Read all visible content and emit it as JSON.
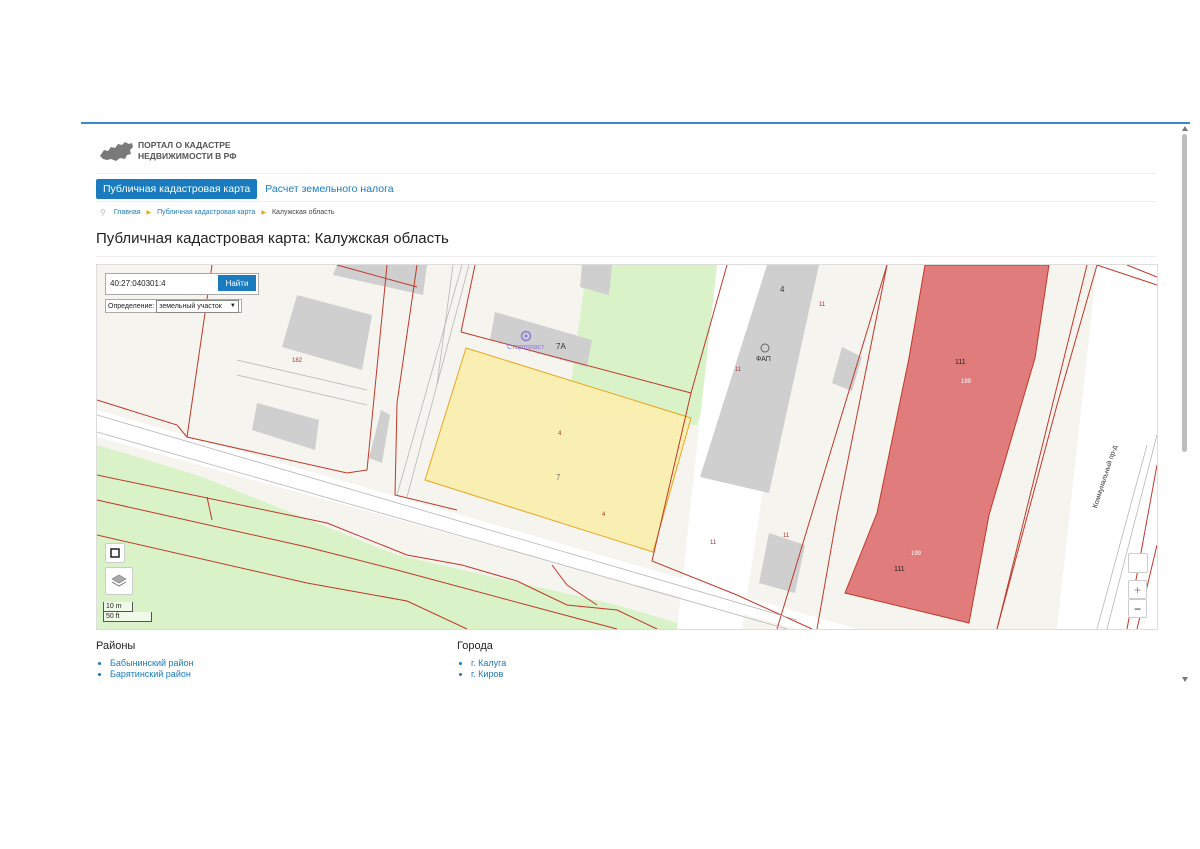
{
  "logo": {
    "text": "ПОРТАЛ О КАДАСТРЕ НЕДВИЖИМОСТИ В РФ"
  },
  "nav": {
    "tab_active": "Публичная кадастровая карта",
    "tab_tax": "Расчет земельного налога"
  },
  "breadcrumb": {
    "home": "Главная",
    "map": "Публичная кадастровая карта",
    "current": "Калужская область"
  },
  "page_title": "Публичная кадастровая карта: Калужская область",
  "map": {
    "search_value": "40:27:040301:4",
    "search_button": "Найти",
    "definition_label": "Определение:",
    "definition_value": "земельный участок",
    "scale_m": "10 m",
    "scale_ft": "50 ft",
    "labels": {
      "n182": "182",
      "n7a": "7А",
      "startplast": "Стартпласт",
      "n4": "4",
      "fap": "ФАП",
      "n11a": "11",
      "n11b": "11",
      "n11c": "11",
      "n11d": "11",
      "n111a": "111",
      "n111b": "111",
      "n199a": "199",
      "n199b": "199",
      "n7": "7",
      "n4a": "4",
      "n4b": "4",
      "street": "Коммунальный пр-д"
    },
    "zoom_in": "+",
    "zoom_out": "−"
  },
  "districts": {
    "title": "Районы",
    "items": [
      "Бабынинский район",
      "Барятинский район"
    ]
  },
  "cities": {
    "title": "Города",
    "items": [
      "г. Калуга",
      "г. Киров"
    ]
  },
  "colors": {
    "accent": "#1a7bbf",
    "parcel_highlight": "#fbefb0",
    "parcel_red": "#e07c7c",
    "green_area": "#d9f2c7",
    "border_red": "#c0392b"
  }
}
